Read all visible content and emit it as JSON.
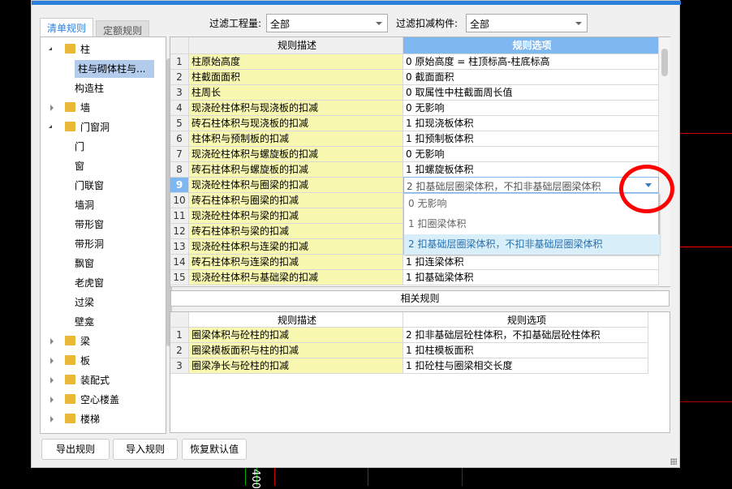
{
  "filters": {
    "quantity_label": "过滤工程量:",
    "quantity_value": "全部",
    "component_label": "过滤扣减构件:",
    "component_value": "全部"
  },
  "tabs": [
    "清单规则",
    "定额规则"
  ],
  "tree": [
    {
      "label": "柱",
      "level": 0,
      "state": "open"
    },
    {
      "label": "柱与砌体柱与...",
      "level": 1,
      "selected": true
    },
    {
      "label": "构造柱",
      "level": 1
    },
    {
      "label": "墙",
      "level": 0,
      "state": "closed"
    },
    {
      "label": "门窗洞",
      "level": 0,
      "state": "open"
    },
    {
      "label": "门",
      "level": 1
    },
    {
      "label": "窗",
      "level": 1
    },
    {
      "label": "门联窗",
      "level": 1
    },
    {
      "label": "墙洞",
      "level": 1
    },
    {
      "label": "带形窗",
      "level": 1
    },
    {
      "label": "带形洞",
      "level": 1
    },
    {
      "label": "飘窗",
      "level": 1
    },
    {
      "label": "老虎窗",
      "level": 1
    },
    {
      "label": "过梁",
      "level": 1
    },
    {
      "label": "壁龛",
      "level": 1
    },
    {
      "label": "梁",
      "level": 0,
      "state": "closed"
    },
    {
      "label": "板",
      "level": 0,
      "state": "closed"
    },
    {
      "label": "装配式",
      "level": 0,
      "state": "closed"
    },
    {
      "label": "空心楼盖",
      "level": 0,
      "state": "closed"
    },
    {
      "label": "楼梯",
      "level": 0,
      "state": "closed"
    }
  ],
  "main_grid": {
    "headers": [
      "规则描述",
      "规则选项"
    ],
    "rows": [
      [
        "1",
        "柱原始高度",
        "0 原始高度 = 柱顶标高-柱底标高"
      ],
      [
        "2",
        "柱截面面积",
        "0 截面面积"
      ],
      [
        "3",
        "柱周长",
        "0 取属性中柱截面周长值"
      ],
      [
        "4",
        "现浇砼柱体积与现浇板的扣减",
        "0  无影响"
      ],
      [
        "5",
        "砖石柱体积与现浇板的扣减",
        "1 扣现浇板体积"
      ],
      [
        "6",
        "柱体积与预制板的扣减",
        "1 扣预制板体积"
      ],
      [
        "7",
        "现浇砼柱体积与螺旋板的扣减",
        "0  无影响"
      ],
      [
        "8",
        "砖石柱体积与螺旋板的扣减",
        "1 扣螺旋板体积"
      ],
      [
        "9",
        "现浇砼柱体积与圈梁的扣减",
        "2 扣基础层圈梁体积，不扣非基础层圈梁体积"
      ],
      [
        "10",
        "砖石柱体积与圈梁的扣减",
        ""
      ],
      [
        "11",
        "现浇砼柱体积与梁的扣减",
        ""
      ],
      [
        "12",
        "砖石柱体积与梁的扣减",
        ""
      ],
      [
        "13",
        "现浇砼柱体积与连梁的扣减",
        ""
      ],
      [
        "14",
        "砖石柱体积与连梁的扣减",
        "1 扣连梁体积"
      ],
      [
        "15",
        "现浇砼柱体积与基础梁的扣减",
        "1 扣基础梁体积"
      ]
    ],
    "dropdown_options": [
      "0  无影响",
      "1 扣圈梁体积",
      "2 扣基础层圈梁体积，不扣非基础层圈梁体积"
    ]
  },
  "related_title": "相关规则",
  "related_grid": {
    "headers": [
      "规则描述",
      "规则选项"
    ],
    "rows": [
      [
        "1",
        "圈梁体积与砼柱的扣减",
        "2 扣非基础层砼柱体积，不扣基础层砼柱体积"
      ],
      [
        "2",
        "圈梁模板面积与柱的扣减",
        "1 扣柱模板面积"
      ],
      [
        "3",
        "圈梁净长与砼柱的扣减",
        "1 扣砼柱与圈梁相交长度"
      ]
    ]
  },
  "buttons": [
    "导出规则",
    "导入规则",
    "恢复默认值"
  ],
  "canvas_label": "400",
  "colors": {
    "accent": "#2b7fdc",
    "header_selected": "#7fb8f0",
    "desc_bg": "#f8f8b0",
    "annotation": "#ff0000"
  }
}
